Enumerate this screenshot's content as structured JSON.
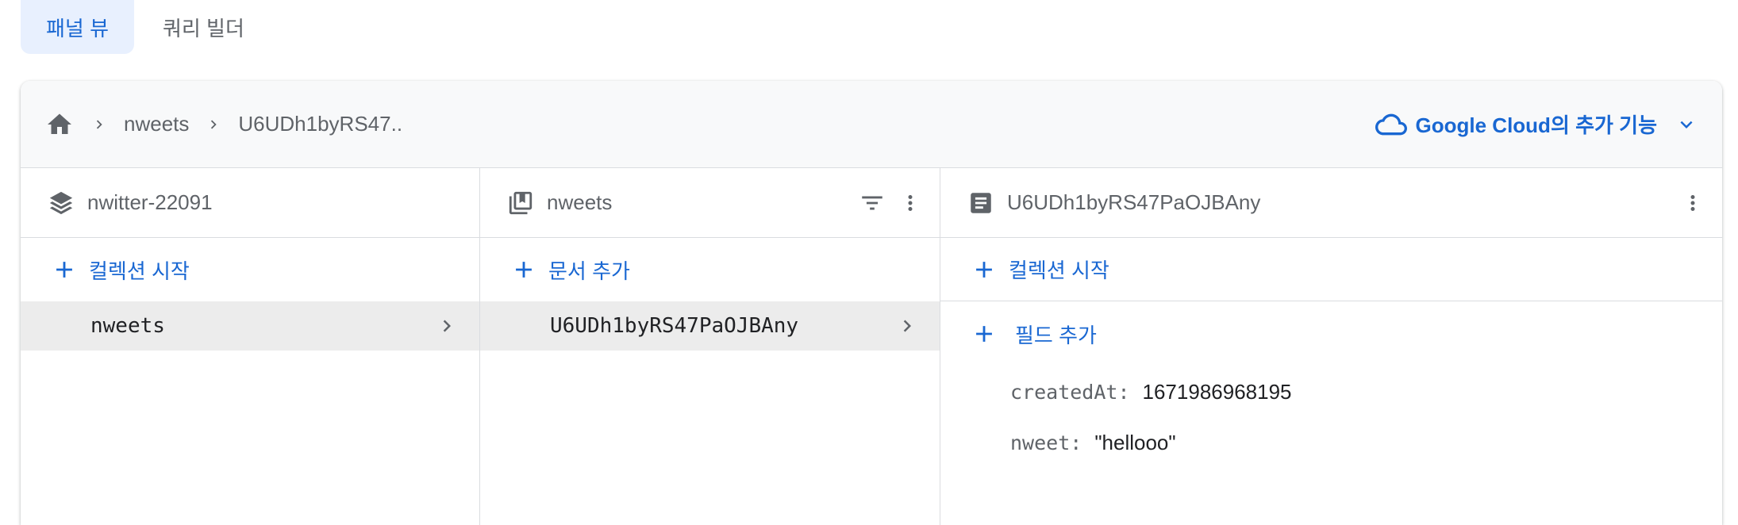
{
  "tabs": [
    {
      "label": "패널 뷰",
      "active": true
    },
    {
      "label": "쿼리 빌더",
      "active": false
    }
  ],
  "header": {
    "breadcrumb": [
      "nweets",
      "U6UDh1byRS47.."
    ],
    "google_cloud_link": "Google Cloud의 추가 기능"
  },
  "columns": {
    "root": {
      "title": "nwitter-22091",
      "add_label": "컬렉션 시작",
      "items": [
        "nweets"
      ]
    },
    "collection": {
      "title": "nweets",
      "add_label": "문서 추가",
      "items": [
        "U6UDh1byRS47PaOJBAny"
      ]
    },
    "document": {
      "title": "U6UDh1byRS47PaOJBAny",
      "add_collection_label": "컬렉션 시작",
      "add_field_label": "필드 추가",
      "fields": [
        {
          "key": "createdAt:",
          "value": "1671986968195"
        },
        {
          "key": "nweet:",
          "value": "\"hellooo\""
        }
      ]
    }
  },
  "colors": {
    "accent": "#1967d2",
    "active_tab_bg": "#e8f0fe",
    "selected_row_bg": "#ececec"
  }
}
